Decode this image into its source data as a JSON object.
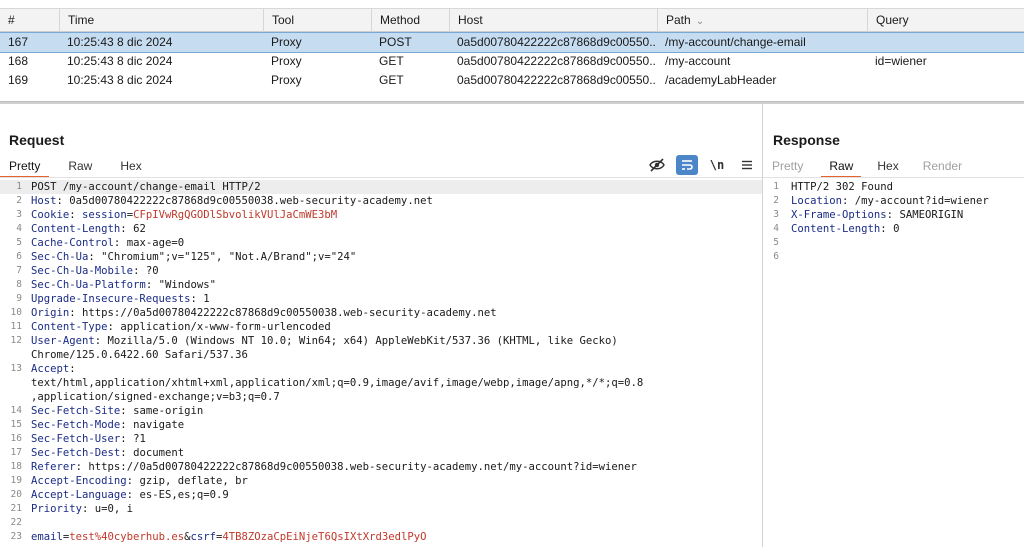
{
  "history": {
    "columns": [
      "#",
      "Time",
      "Tool",
      "Method",
      "Host",
      "Path",
      "Query"
    ],
    "rows": [
      {
        "num": "167",
        "time": "10:25:43 8 dic 2024",
        "tool": "Proxy",
        "method": "POST",
        "host": "0a5d00780422222c87868d9c00550...",
        "path": "/my-account/change-email",
        "query": "",
        "selected": true
      },
      {
        "num": "168",
        "time": "10:25:43 8 dic 2024",
        "tool": "Proxy",
        "method": "GET",
        "host": "0a5d00780422222c87868d9c00550...",
        "path": "/my-account",
        "query": "id=wiener",
        "selected": false
      },
      {
        "num": "169",
        "time": "10:25:43 8 dic 2024",
        "tool": "Proxy",
        "method": "GET",
        "host": "0a5d00780422222c87868d9c00550...",
        "path": "/academyLabHeader",
        "query": "",
        "selected": false
      }
    ]
  },
  "request": {
    "title": "Request",
    "tabs": [
      "Pretty",
      "Raw",
      "Hex"
    ],
    "active_tab": "Pretty",
    "tools": {
      "hide_icon": "eye-slash-icon",
      "wrap_icon": "word-wrap-icon",
      "newline_label": "\\n",
      "menu_icon": "hamburger-menu-icon"
    },
    "lines": [
      {
        "n": "1",
        "k": "",
        "v": "POST /my-account/change-email HTTP/2"
      },
      {
        "n": "2",
        "k": "Host",
        "v": "0a5d00780422222c87868d9c00550038.web-security-academy.net"
      },
      {
        "n": "3",
        "k": "Cookie",
        "v": ""
      },
      {
        "n": "4",
        "k": "Content-Length",
        "v": "62"
      },
      {
        "n": "5",
        "k": "Cache-Control",
        "v": "max-age=0"
      },
      {
        "n": "6",
        "k": "Sec-Ch-Ua",
        "v": "\"Chromium\";v=\"125\", \"Not.A/Brand\";v=\"24\""
      },
      {
        "n": "7",
        "k": "Sec-Ch-Ua-Mobile",
        "v": "?0"
      },
      {
        "n": "8",
        "k": "Sec-Ch-Ua-Platform",
        "v": "\"Windows\""
      },
      {
        "n": "9",
        "k": "Upgrade-Insecure-Requests",
        "v": "1"
      },
      {
        "n": "10",
        "k": "Origin",
        "v": "https://0a5d00780422222c87868d9c00550038.web-security-academy.net"
      },
      {
        "n": "11",
        "k": "Content-Type",
        "v": "application/x-www-form-urlencoded"
      },
      {
        "n": "12",
        "k": "User-Agent",
        "v": "Mozilla/5.0 (Windows NT 10.0; Win64; x64) AppleWebKit/537.36 (KHTML, like Gecko)"
      },
      {
        "n": "",
        "k": "",
        "v": "Chrome/125.0.6422.60 Safari/537.36"
      },
      {
        "n": "13",
        "k": "Accept",
        "v": ""
      },
      {
        "n": "",
        "k": "",
        "v": "text/html,application/xhtml+xml,application/xml;q=0.9,image/avif,image/webp,image/apng,*/*;q=0.8"
      },
      {
        "n": "",
        "k": "",
        "v": ",application/signed-exchange;v=b3;q=0.7"
      },
      {
        "n": "14",
        "k": "Sec-Fetch-Site",
        "v": "same-origin"
      },
      {
        "n": "15",
        "k": "Sec-Fetch-Mode",
        "v": "navigate"
      },
      {
        "n": "16",
        "k": "Sec-Fetch-User",
        "v": "?1"
      },
      {
        "n": "17",
        "k": "Sec-Fetch-Dest",
        "v": "document"
      },
      {
        "n": "18",
        "k": "Referer",
        "v": "https://0a5d00780422222c87868d9c00550038.web-security-academy.net/my-account?id=wiener"
      },
      {
        "n": "19",
        "k": "Accept-Encoding",
        "v": "gzip, deflate, br"
      },
      {
        "n": "20",
        "k": "Accept-Language",
        "v": "es-ES,es;q=0.9"
      },
      {
        "n": "21",
        "k": "Priority",
        "v": "u=0, i"
      },
      {
        "n": "22",
        "k": "",
        "v": ""
      }
    ],
    "cookie": {
      "name": "session",
      "value": "CFpIVwRgQGODlSbvolikVUlJaCmWE3bM"
    },
    "body": {
      "n": "23",
      "email_key": "email",
      "email_val": "test%40cyberhub.es",
      "amp": "&",
      "csrf_key": "csrf",
      "csrf_val": "4TB8ZOzaCpEiNjeT6QsIXtXrd3edlPyO"
    }
  },
  "response": {
    "title": "Response",
    "tabs": [
      "Pretty",
      "Raw",
      "Hex",
      "Render"
    ],
    "active_tab": "Raw",
    "lines": [
      {
        "n": "1",
        "k": "",
        "v": "HTTP/2 302 Found"
      },
      {
        "n": "2",
        "k": "Location",
        "v": "/my-account?id=wiener"
      },
      {
        "n": "3",
        "k": "X-Frame-Options",
        "v": "SAMEORIGIN"
      },
      {
        "n": "4",
        "k": "Content-Length",
        "v": "0"
      },
      {
        "n": "5",
        "k": "",
        "v": ""
      },
      {
        "n": "6",
        "k": "",
        "v": ""
      }
    ]
  },
  "colors": {
    "accent": "#e8612c",
    "selection": "#c5dcf1",
    "header_key": "#1b2c86",
    "param_value": "#c0392b",
    "tool_active": "#4a86c8"
  }
}
